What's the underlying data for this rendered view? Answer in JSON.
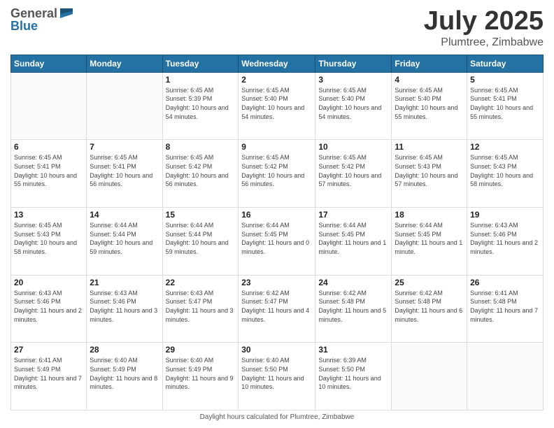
{
  "header": {
    "logo_general": "General",
    "logo_blue": "Blue",
    "month_title": "July 2025",
    "location": "Plumtree, Zimbabwe"
  },
  "calendar": {
    "days_of_week": [
      "Sunday",
      "Monday",
      "Tuesday",
      "Wednesday",
      "Thursday",
      "Friday",
      "Saturday"
    ],
    "weeks": [
      [
        {
          "day": "",
          "info": ""
        },
        {
          "day": "",
          "info": ""
        },
        {
          "day": "1",
          "info": "Sunrise: 6:45 AM\nSunset: 5:39 PM\nDaylight: 10 hours and 54 minutes."
        },
        {
          "day": "2",
          "info": "Sunrise: 6:45 AM\nSunset: 5:40 PM\nDaylight: 10 hours and 54 minutes."
        },
        {
          "day": "3",
          "info": "Sunrise: 6:45 AM\nSunset: 5:40 PM\nDaylight: 10 hours and 54 minutes."
        },
        {
          "day": "4",
          "info": "Sunrise: 6:45 AM\nSunset: 5:40 PM\nDaylight: 10 hours and 55 minutes."
        },
        {
          "day": "5",
          "info": "Sunrise: 6:45 AM\nSunset: 5:41 PM\nDaylight: 10 hours and 55 minutes."
        }
      ],
      [
        {
          "day": "6",
          "info": "Sunrise: 6:45 AM\nSunset: 5:41 PM\nDaylight: 10 hours and 55 minutes."
        },
        {
          "day": "7",
          "info": "Sunrise: 6:45 AM\nSunset: 5:41 PM\nDaylight: 10 hours and 56 minutes."
        },
        {
          "day": "8",
          "info": "Sunrise: 6:45 AM\nSunset: 5:42 PM\nDaylight: 10 hours and 56 minutes."
        },
        {
          "day": "9",
          "info": "Sunrise: 6:45 AM\nSunset: 5:42 PM\nDaylight: 10 hours and 56 minutes."
        },
        {
          "day": "10",
          "info": "Sunrise: 6:45 AM\nSunset: 5:42 PM\nDaylight: 10 hours and 57 minutes."
        },
        {
          "day": "11",
          "info": "Sunrise: 6:45 AM\nSunset: 5:43 PM\nDaylight: 10 hours and 57 minutes."
        },
        {
          "day": "12",
          "info": "Sunrise: 6:45 AM\nSunset: 5:43 PM\nDaylight: 10 hours and 58 minutes."
        }
      ],
      [
        {
          "day": "13",
          "info": "Sunrise: 6:45 AM\nSunset: 5:43 PM\nDaylight: 10 hours and 58 minutes."
        },
        {
          "day": "14",
          "info": "Sunrise: 6:44 AM\nSunset: 5:44 PM\nDaylight: 10 hours and 59 minutes."
        },
        {
          "day": "15",
          "info": "Sunrise: 6:44 AM\nSunset: 5:44 PM\nDaylight: 10 hours and 59 minutes."
        },
        {
          "day": "16",
          "info": "Sunrise: 6:44 AM\nSunset: 5:45 PM\nDaylight: 11 hours and 0 minutes."
        },
        {
          "day": "17",
          "info": "Sunrise: 6:44 AM\nSunset: 5:45 PM\nDaylight: 11 hours and 1 minute."
        },
        {
          "day": "18",
          "info": "Sunrise: 6:44 AM\nSunset: 5:45 PM\nDaylight: 11 hours and 1 minute."
        },
        {
          "day": "19",
          "info": "Sunrise: 6:43 AM\nSunset: 5:46 PM\nDaylight: 11 hours and 2 minutes."
        }
      ],
      [
        {
          "day": "20",
          "info": "Sunrise: 6:43 AM\nSunset: 5:46 PM\nDaylight: 11 hours and 2 minutes."
        },
        {
          "day": "21",
          "info": "Sunrise: 6:43 AM\nSunset: 5:46 PM\nDaylight: 11 hours and 3 minutes."
        },
        {
          "day": "22",
          "info": "Sunrise: 6:43 AM\nSunset: 5:47 PM\nDaylight: 11 hours and 3 minutes."
        },
        {
          "day": "23",
          "info": "Sunrise: 6:42 AM\nSunset: 5:47 PM\nDaylight: 11 hours and 4 minutes."
        },
        {
          "day": "24",
          "info": "Sunrise: 6:42 AM\nSunset: 5:48 PM\nDaylight: 11 hours and 5 minutes."
        },
        {
          "day": "25",
          "info": "Sunrise: 6:42 AM\nSunset: 5:48 PM\nDaylight: 11 hours and 6 minutes."
        },
        {
          "day": "26",
          "info": "Sunrise: 6:41 AM\nSunset: 5:48 PM\nDaylight: 11 hours and 7 minutes."
        }
      ],
      [
        {
          "day": "27",
          "info": "Sunrise: 6:41 AM\nSunset: 5:49 PM\nDaylight: 11 hours and 7 minutes."
        },
        {
          "day": "28",
          "info": "Sunrise: 6:40 AM\nSunset: 5:49 PM\nDaylight: 11 hours and 8 minutes."
        },
        {
          "day": "29",
          "info": "Sunrise: 6:40 AM\nSunset: 5:49 PM\nDaylight: 11 hours and 9 minutes."
        },
        {
          "day": "30",
          "info": "Sunrise: 6:40 AM\nSunset: 5:50 PM\nDaylight: 11 hours and 10 minutes."
        },
        {
          "day": "31",
          "info": "Sunrise: 6:39 AM\nSunset: 5:50 PM\nDaylight: 11 hours and 10 minutes."
        },
        {
          "day": "",
          "info": ""
        },
        {
          "day": "",
          "info": ""
        }
      ]
    ]
  },
  "footer": {
    "note": "Daylight hours calculated for Plumtree, Zimbabwe"
  }
}
